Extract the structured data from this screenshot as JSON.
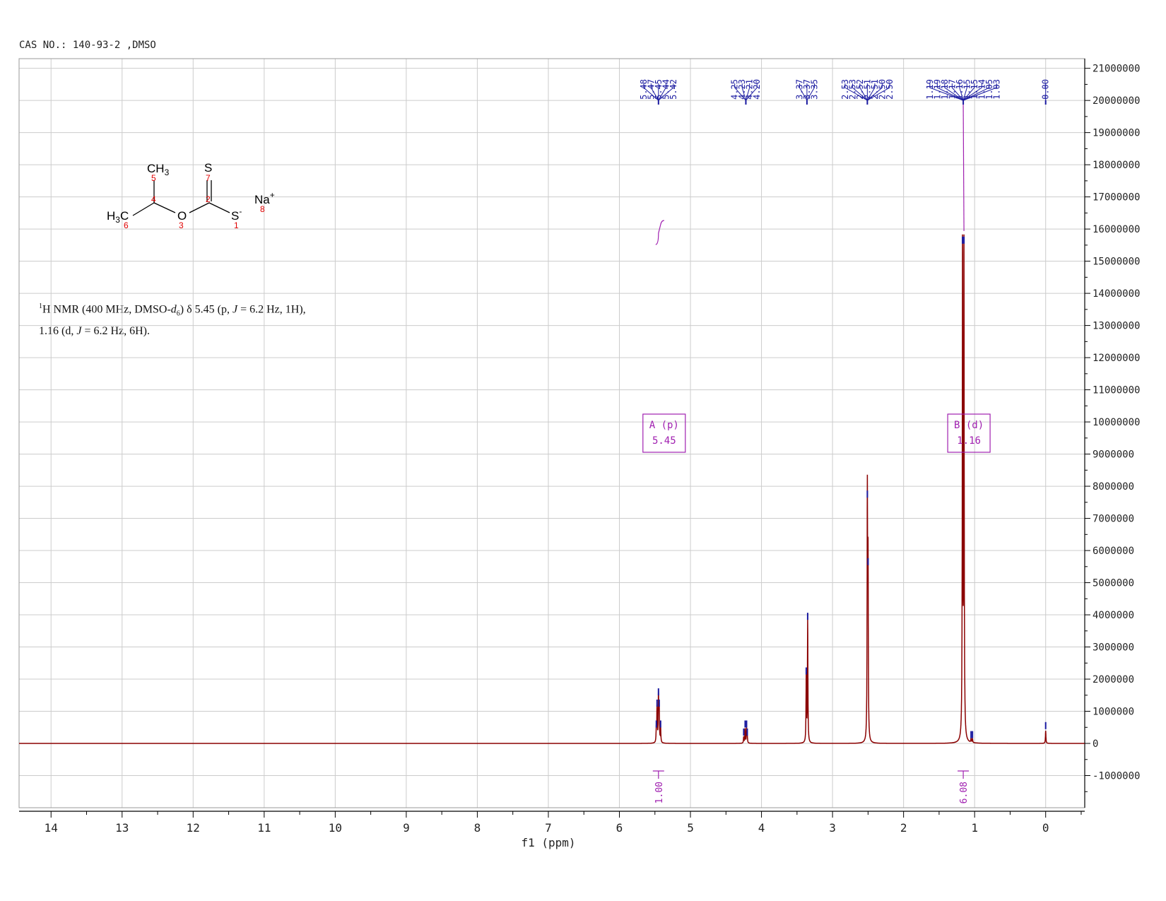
{
  "header": {
    "title": "CAS NO.: 140-93-2 ,DMSO"
  },
  "description": {
    "line1_sup": "1",
    "line1_a": "H NMR (400 MHz, DMSO-",
    "line1_d": "d",
    "line1_sub": "6",
    "line1_b": ") δ 5.45 (p, ",
    "line1_J": "J",
    "line1_c": " = 6.2 Hz, 1H),",
    "line2_a": "1.16 (d, ",
    "line2_J": "J",
    "line2_b": " = 6.2 Hz, 6H)."
  },
  "structure": {
    "atoms": [
      {
        "label": "CH3",
        "number": "5"
      },
      {
        "label": "H3C",
        "number": "6"
      },
      {
        "label": "",
        "number": "4"
      },
      {
        "label": "O",
        "number": "3"
      },
      {
        "label": "",
        "number": "2"
      },
      {
        "label": "S",
        "number": "7"
      },
      {
        "label": "S-",
        "number": "1"
      },
      {
        "label": "Na+",
        "number": "8"
      }
    ]
  },
  "colors": {
    "spectrum": "#8b0000",
    "peak_labels": "#1a1aa0",
    "integral": "#a020b0",
    "grid": "#cccccc",
    "axis": "#000000",
    "atom_numbers": "#e00000"
  },
  "chart_data": {
    "type": "line",
    "title": "CAS NO.: 140-93-2 ,DMSO",
    "xlabel": "f1 (ppm)",
    "ylabel": "",
    "xlim": [
      14.45,
      -0.55
    ],
    "ylim": [
      -2000000,
      21300000
    ],
    "x_reversed": true,
    "grid": true,
    "x_ticks": [
      "14",
      "13",
      "12",
      "11",
      "10",
      "9",
      "8",
      "7",
      "6",
      "5",
      "4",
      "3",
      "2",
      "1",
      "0"
    ],
    "y_ticks": [
      "21000000",
      "20000000",
      "19000000",
      "18000000",
      "17000000",
      "16000000",
      "15000000",
      "14000000",
      "13000000",
      "12000000",
      "11000000",
      "10000000",
      "9000000",
      "8000000",
      "7000000",
      "6000000",
      "5000000",
      "4000000",
      "3000000",
      "2000000",
      "1000000",
      "0",
      "-1000000"
    ],
    "peaks": [
      {
        "ppm": 5.48,
        "intensity": 450000
      },
      {
        "ppm": 5.47,
        "intensity": 1100000
      },
      {
        "ppm": 5.45,
        "intensity": 1450000
      },
      {
        "ppm": 5.44,
        "intensity": 1100000
      },
      {
        "ppm": 5.42,
        "intensity": 450000
      },
      {
        "ppm": 4.25,
        "intensity": 200000
      },
      {
        "ppm": 4.23,
        "intensity": 450000
      },
      {
        "ppm": 4.21,
        "intensity": 450000
      },
      {
        "ppm": 4.2,
        "intensity": 200000
      },
      {
        "ppm": 3.37,
        "intensity": 2100000
      },
      {
        "ppm": 3.35,
        "intensity": 3800000
      },
      {
        "ppm": 2.51,
        "intensity": 7600000
      },
      {
        "ppm": 2.5,
        "intensity": 5500000
      },
      {
        "ppm": 1.17,
        "intensity": 15500000
      },
      {
        "ppm": 1.15,
        "intensity": 15500000
      },
      {
        "ppm": 1.05,
        "intensity": 120000
      },
      {
        "ppm": 1.03,
        "intensity": 120000
      },
      {
        "ppm": 0.0,
        "intensity": 400000
      }
    ],
    "peak_labels": [
      {
        "group": "5.48,5.47,5.45,5.44,5.42",
        "labels": [
          "5.48",
          "5.47",
          "5.45",
          "5.44",
          "5.42"
        ],
        "center": 5.45
      },
      {
        "group": "4.25-4.20",
        "labels": [
          "4.25",
          "4.23",
          "4.21",
          "4.20"
        ],
        "center": 4.22
      },
      {
        "group": "3.37-3.35",
        "labels": [
          "3.37",
          "3.37",
          "3.35"
        ],
        "center": 3.36
      },
      {
        "group": "2.53-2.50",
        "labels": [
          "2.53",
          "2.53",
          "2.52",
          "2.51",
          "2.51",
          "2.50",
          "2.50"
        ],
        "center": 2.51
      },
      {
        "group": "1.19-1.03",
        "labels": [
          "1.19",
          "1.19",
          "1.18",
          "1.17",
          "1.16",
          "1.15",
          "1.15",
          "1.14",
          "1.05",
          "1.03"
        ],
        "center": 1.16
      },
      {
        "group": "0.00",
        "labels": [
          "-0.00"
        ],
        "center": 0.0
      }
    ],
    "multiplets": [
      {
        "name": "A",
        "mult": "(p)",
        "shift": "5.45",
        "integral": "1.00",
        "ppm": 5.45
      },
      {
        "name": "B",
        "mult": "(d)",
        "shift": "1.16",
        "integral": "6.08",
        "ppm": 1.16
      }
    ]
  }
}
